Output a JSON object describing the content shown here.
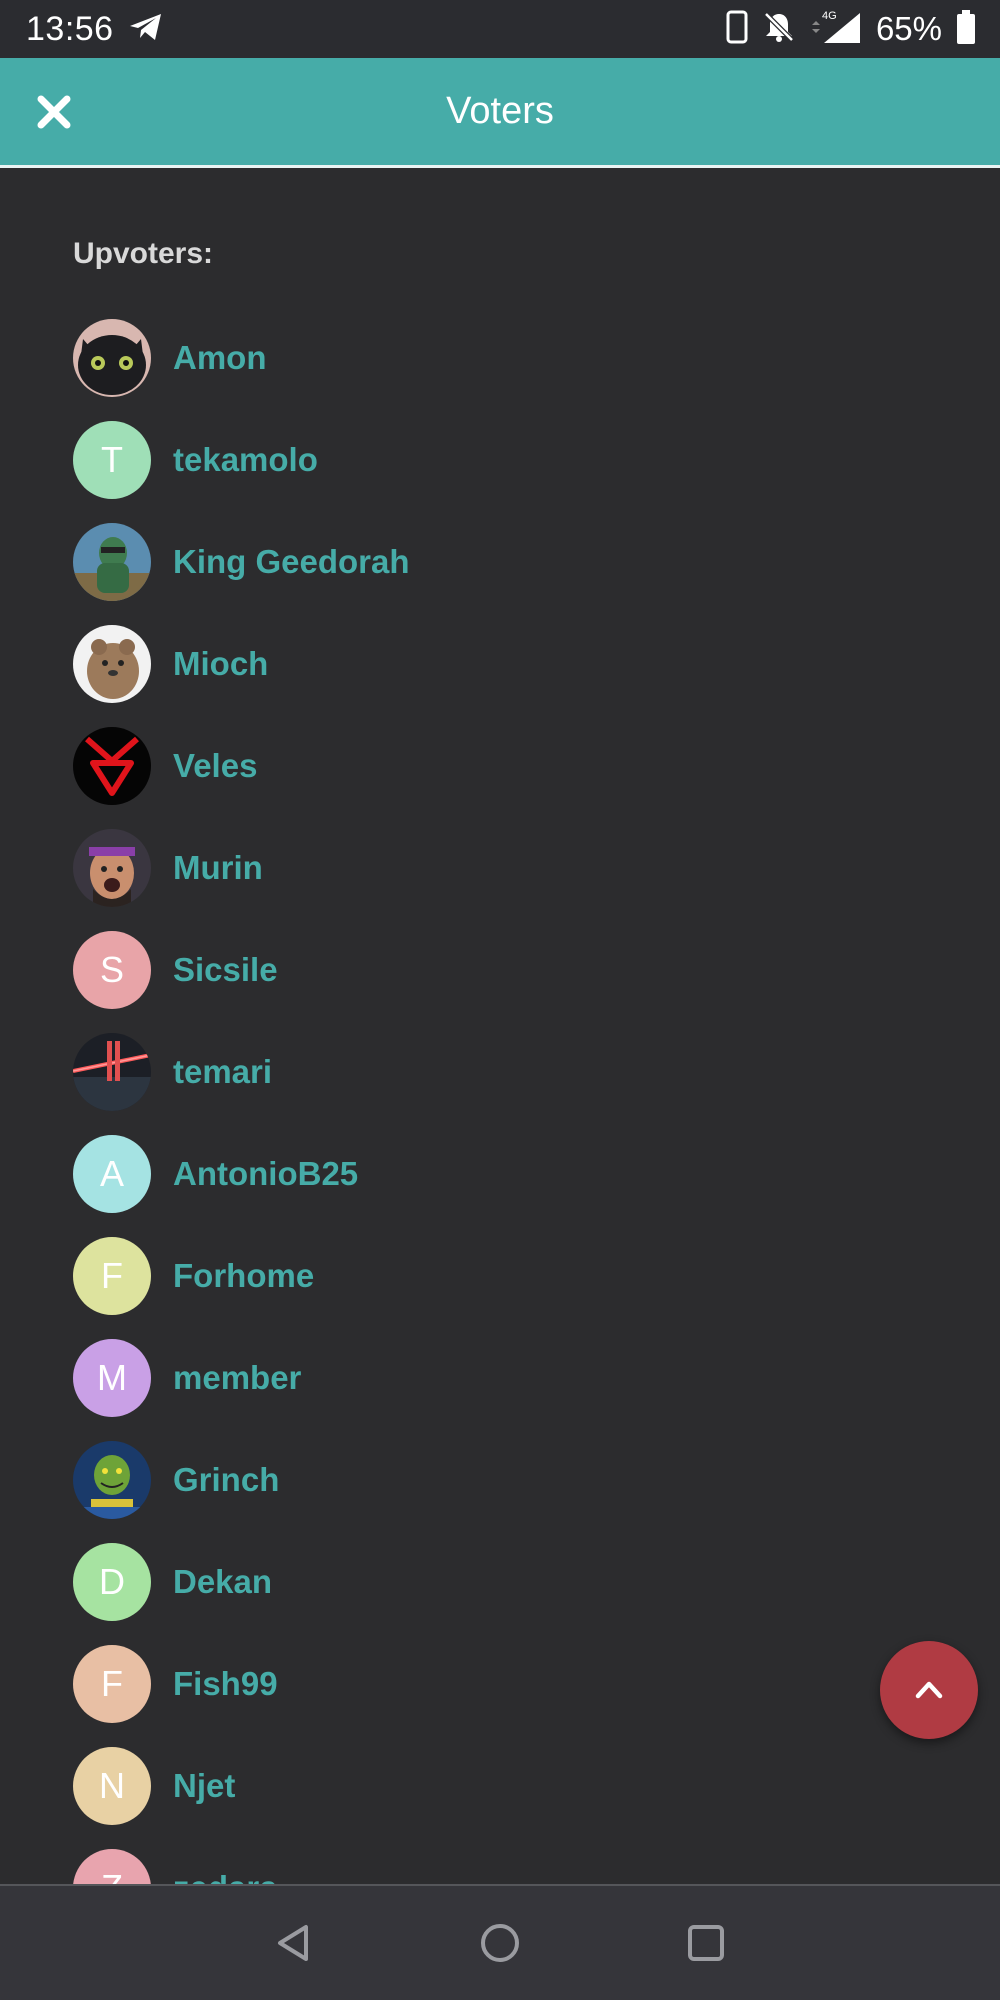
{
  "status_bar": {
    "time": "13:56",
    "battery": "65%",
    "network": "4G",
    "icons": [
      "telegram-icon",
      "phone-icon",
      "bell-muted-icon",
      "signal-icon",
      "battery-icon"
    ]
  },
  "app_bar": {
    "title": "Voters",
    "close_icon": "close-icon",
    "color": "#46aca8"
  },
  "section": {
    "label": "Upvoters:"
  },
  "upvoters": [
    {
      "name": "Amon",
      "avatar": "image",
      "image_hint": "dark-dragon"
    },
    {
      "name": "tekamolo",
      "avatar": "letter",
      "letter": "T",
      "color": "#9fdfb7"
    },
    {
      "name": "King Geedorah",
      "avatar": "image",
      "image_hint": "green-figure"
    },
    {
      "name": "Mioch",
      "avatar": "image",
      "image_hint": "quokka"
    },
    {
      "name": "Veles",
      "avatar": "image",
      "image_hint": "red-symbol"
    },
    {
      "name": "Murin",
      "avatar": "image",
      "image_hint": "face-headband"
    },
    {
      "name": "Sicsile",
      "avatar": "letter",
      "letter": "S",
      "color": "#e8a4a8"
    },
    {
      "name": "temari",
      "avatar": "image",
      "image_hint": "red-glow"
    },
    {
      "name": "AntonioB25",
      "avatar": "letter",
      "letter": "A",
      "color": "#a5e3e3"
    },
    {
      "name": "Forhome",
      "avatar": "letter",
      "letter": "F",
      "color": "#dde39e"
    },
    {
      "name": "member",
      "avatar": "letter",
      "letter": "M",
      "color": "#c9a0e6"
    },
    {
      "name": "Grinch",
      "avatar": "image",
      "image_hint": "grinch-poster"
    },
    {
      "name": "Dekan",
      "avatar": "letter",
      "letter": "D",
      "color": "#a6e3a1"
    },
    {
      "name": "Fish99",
      "avatar": "letter",
      "letter": "F",
      "color": "#e8bfa4"
    },
    {
      "name": "Njet",
      "avatar": "letter",
      "letter": "N",
      "color": "#e8d1a4"
    },
    {
      "name": "zedara",
      "avatar": "letter",
      "letter": "Z",
      "color": "#e8a4ae"
    }
  ],
  "fab": {
    "icon": "chevron-up-icon",
    "color": "#b03b43"
  },
  "nav_bar": {
    "icons": [
      "back-icon",
      "home-icon",
      "recents-icon"
    ]
  }
}
